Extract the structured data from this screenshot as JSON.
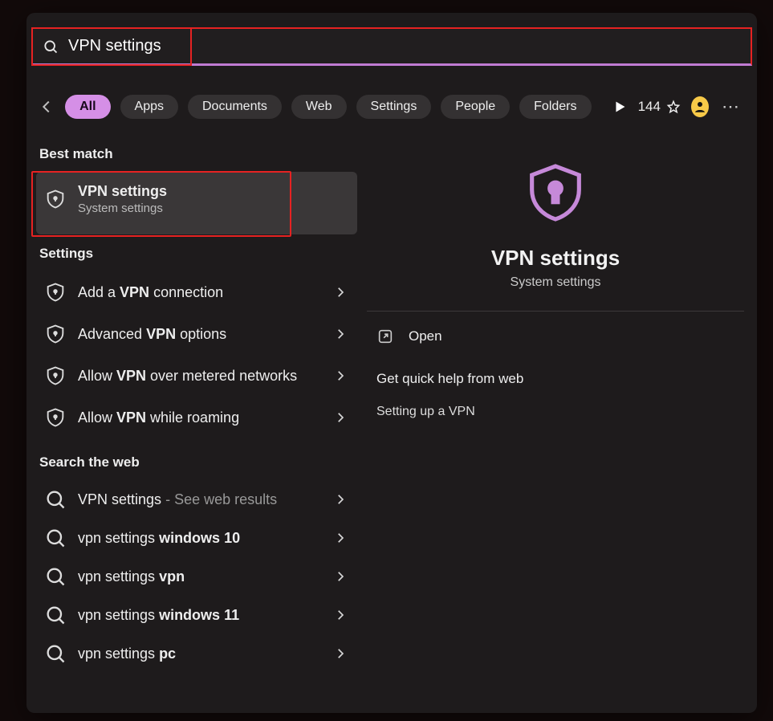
{
  "search": {
    "value": "VPN settings"
  },
  "tabs": {
    "all": "All",
    "apps": "Apps",
    "documents": "Documents",
    "web": "Web",
    "settings": "Settings",
    "people": "People",
    "folders": "Folders"
  },
  "points": "144",
  "sections": {
    "best_match": "Best match",
    "settings": "Settings",
    "search_web": "Search the web"
  },
  "best": {
    "title": "VPN settings",
    "sub": "System settings"
  },
  "settings_results": [
    {
      "pre": "Add a ",
      "bold": "VPN",
      "post": " connection"
    },
    {
      "pre": "Advanced ",
      "bold": "VPN",
      "post": " options"
    },
    {
      "pre": "Allow ",
      "bold": "VPN",
      "post": " over metered networks"
    },
    {
      "pre": "Allow ",
      "bold": "VPN",
      "post": " while roaming"
    }
  ],
  "web_results": [
    {
      "label": "VPN settings",
      "suffix": "See web results"
    },
    {
      "pre": "vpn settings ",
      "bold": "windows 10"
    },
    {
      "pre": "vpn settings ",
      "bold": "vpn"
    },
    {
      "pre": "vpn settings ",
      "bold": "windows 11"
    },
    {
      "pre": "vpn settings ",
      "bold": "pc"
    }
  ],
  "preview": {
    "title": "VPN settings",
    "sub": "System settings",
    "open": "Open",
    "help_head": "Get quick help from web",
    "help_link": "Setting up a VPN"
  }
}
